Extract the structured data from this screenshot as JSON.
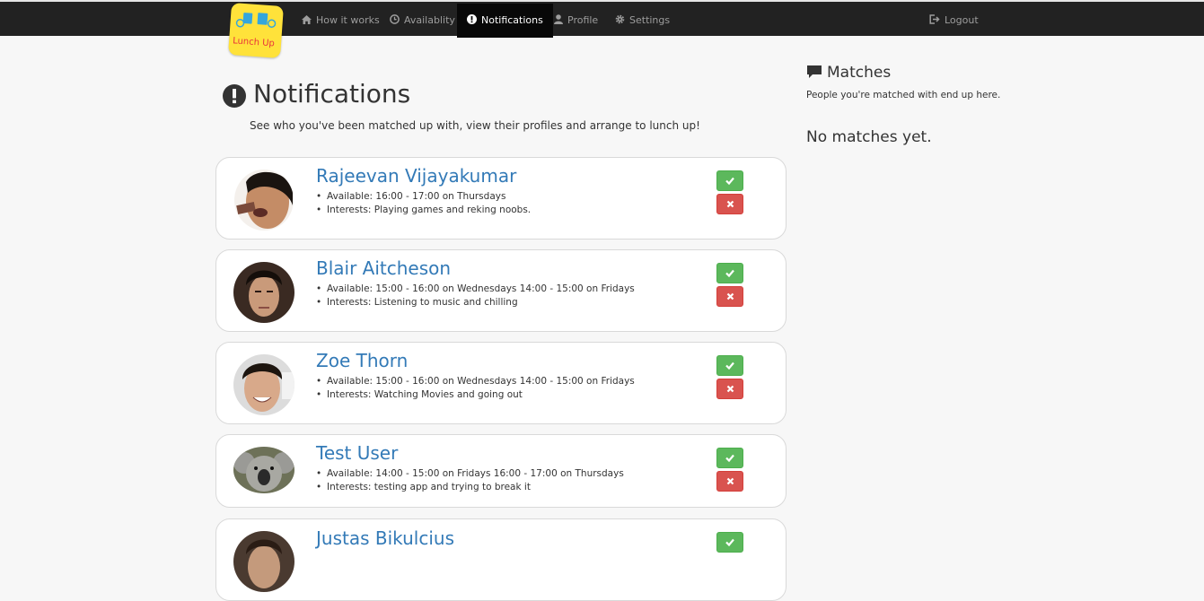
{
  "navbar": {
    "logo_text": "Lunch Up",
    "items": [
      {
        "label": "How it works",
        "icon": "home-icon"
      },
      {
        "label": "Availablity",
        "icon": "clock-icon"
      },
      {
        "label": "Notifications",
        "icon": "exclamation-icon"
      },
      {
        "label": "Profile",
        "icon": "user-icon"
      },
      {
        "label": "Settings",
        "icon": "gear-icon"
      }
    ],
    "active_item": "Notifications",
    "logout": {
      "label": "Logout",
      "icon": "logout-icon"
    }
  },
  "page": {
    "title": "Notifications",
    "subtitle": "See who you've been matched up with, view their profiles and arrange to lunch up!"
  },
  "notifications": [
    {
      "name": "Rajeevan Vijayakumar",
      "available": "Available: 16:00 - 17:00 on Thursdays",
      "interests": "Interests: Playing games and reking noobs."
    },
    {
      "name": "Blair Aitcheson",
      "available": "Available: 15:00 - 16:00 on Wednesdays  14:00 - 15:00 on Fridays",
      "interests": "Interests: Listening to music and chilling"
    },
    {
      "name": "Zoe Thorn",
      "available": "Available: 15:00 - 16:00 on Wednesdays  14:00 - 15:00 on Fridays",
      "interests": "Interests: Watching Movies and going out"
    },
    {
      "name": "Test User",
      "available": "Available: 14:00 - 15:00 on Fridays  16:00 - 17:00 on Thursdays",
      "interests": "Interests: testing app and trying to break it"
    },
    {
      "name": "Justas Bikulcius",
      "available": "",
      "interests": ""
    }
  ],
  "matches": {
    "title": "Matches",
    "subtitle": "People you're matched with end up here.",
    "empty_text": "No matches yet."
  },
  "colors": {
    "navbar_bg": "#222222",
    "active_nav_bg": "#080808",
    "link_blue": "#337ab7",
    "accept_green": "#5cb85c",
    "reject_red": "#d9534f",
    "logo_yellow": "#ffe23a"
  }
}
